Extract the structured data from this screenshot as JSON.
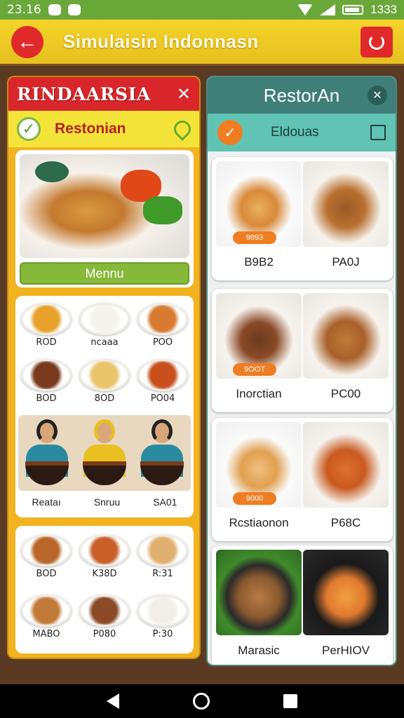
{
  "status_bar": {
    "time": "23.16",
    "right_text": "1333"
  },
  "header": {
    "title": "Simulaisin Indonnasn",
    "back_icon": "arrow-left-icon",
    "refresh_icon": "refresh-icon"
  },
  "left_panel": {
    "title": "RINDAARSIA",
    "subtitle": "Restonian",
    "hero_button": "Mennu",
    "grid_dishes": [
      {
        "label": "ROD",
        "color": "#e8a22c"
      },
      {
        "label": "ncaaa",
        "color": "#f6f2ee"
      },
      {
        "label": "POO",
        "color": "#d87a30"
      },
      {
        "label": "BOD",
        "color": "#7a3a1e"
      },
      {
        "label": "8OD",
        "color": "#e9c46a"
      },
      {
        "label": "PO04",
        "color": "#c8501c"
      }
    ],
    "people_labels": [
      "Reataı",
      "Snruu",
      "SA01"
    ],
    "grid2_dishes": [
      {
        "label": "BOD",
        "color": "#b8662a"
      },
      {
        "label": "K38D",
        "color": "#c9602a"
      },
      {
        "label": "R:31",
        "color": "#e0b070"
      },
      {
        "label": "MABO",
        "color": "#c27a38"
      },
      {
        "label": "P080",
        "color": "#8a4a28"
      },
      {
        "label": "P:30",
        "color": "#f2efe8"
      }
    ]
  },
  "right_panel": {
    "title": "RestorAn",
    "subtitle": "Eldouas",
    "cards": [
      {
        "left": "B9B2",
        "right": "PA0J",
        "tag": "9993"
      },
      {
        "left": "Inorctian",
        "right": "PC00",
        "tag": "9OOT"
      },
      {
        "left": "Rcstiaonon",
        "right": "P68C",
        "tag": "9000"
      },
      {
        "left": "Marasic",
        "right": "PerHIOV",
        "tag": ""
      }
    ]
  }
}
